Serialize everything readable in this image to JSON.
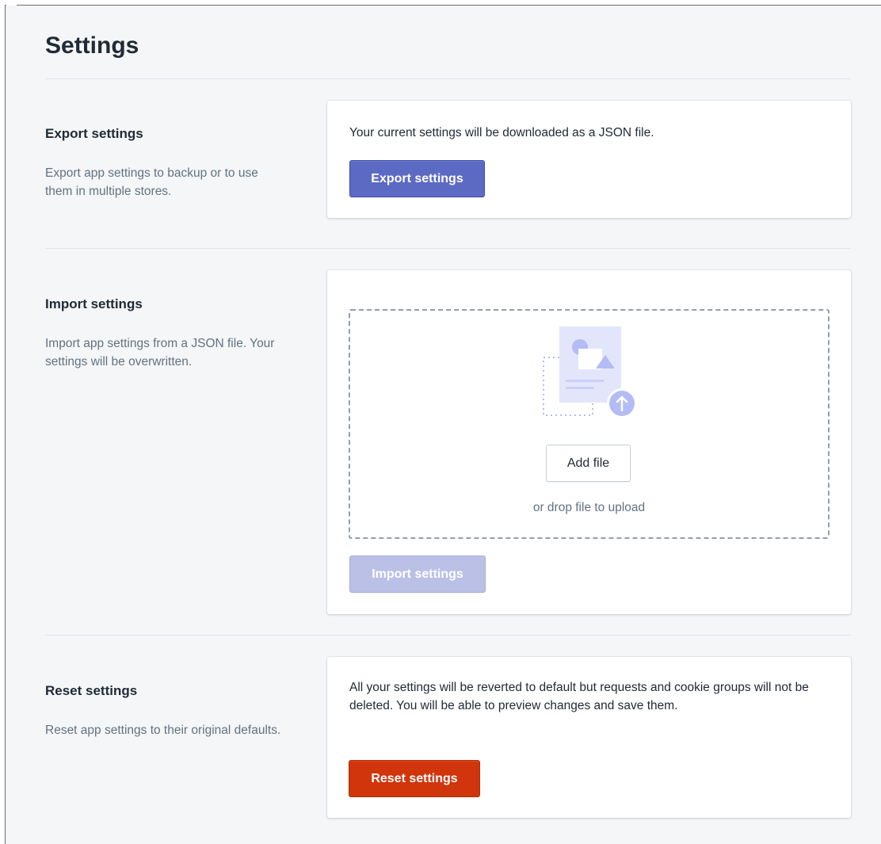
{
  "page": {
    "title": "Settings"
  },
  "export_section": {
    "heading": "Export settings",
    "description": "Export app settings to backup or to use them in multiple stores.",
    "card_text": "Your current settings will be downloaded as a JSON file.",
    "button_label": "Export settings"
  },
  "import_section": {
    "heading": "Import settings",
    "description": "Import app settings from a JSON file. Your settings will be overwritten.",
    "dropzone": {
      "add_file_label": "Add file",
      "hint": "or drop file to upload",
      "illustration_icon": "file-upload-icon"
    },
    "button_label": "Import settings",
    "button_disabled": true
  },
  "reset_section": {
    "heading": "Reset settings",
    "description": "Reset app settings to their original defaults.",
    "card_text": "All your settings will be reverted to default but requests and cookie groups will not be deleted. You will be able to preview changes and save them.",
    "button_label": "Reset settings"
  },
  "colors": {
    "background": "#f4f6f8",
    "primary": "#5c6ac4",
    "primary_disabled": "#bac0e6",
    "destructive": "#d0350c",
    "text": "#212b36",
    "subdued_text": "#637381",
    "divider": "#dfe3e8"
  }
}
